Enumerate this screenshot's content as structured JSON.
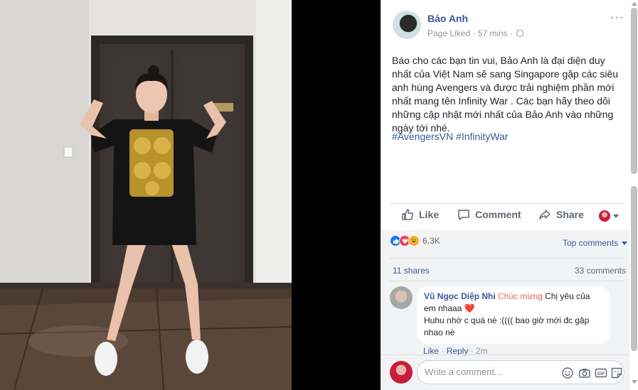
{
  "post": {
    "author": "Bảo Anh",
    "status": "Page Liked",
    "separator": " · ",
    "time": "57 mins",
    "text": "Báo cho các bạn tin vui, Bảo Anh là đại diện duy nhất của Việt Nam sẽ sang Singapore gặp các siêu anh hùng Avengers và được trải nghiệm phần mới nhất mang tên Infinity War . Các bạn hãy theo dõi những cập nhật mới nhất của Bảo Anh vào những ngày tới nhé.",
    "hashtags": [
      "#AvengersVN",
      "#InfinityWar"
    ],
    "more_icon": "more-horizontal-icon"
  },
  "actions": {
    "like": "Like",
    "comment": "Comment",
    "share": "Share"
  },
  "reactions": {
    "icons": [
      "like-reaction-icon",
      "love-reaction-icon",
      "haha-reaction-icon"
    ],
    "count": "6.3K",
    "top_comments": "Top comments"
  },
  "stats": {
    "shares": "11 shares",
    "comments": "33 comments"
  },
  "comment": {
    "author": "Vũ Ngọc Diệp Nhi",
    "mention": "Chúc mừng",
    "text_1": "Chị yêu của em nhaaa",
    "heart": "❤️",
    "text_2": "Huhu nhớ c quá nè :(((( bao giờ mới đc gặp nhao nè",
    "like": "Like",
    "reply": "Reply",
    "time": "2m",
    "dot": " · "
  },
  "composer": {
    "placeholder": "Write a comment...",
    "icons": [
      "emoji-icon",
      "camera-icon",
      "gif-icon",
      "sticker-icon"
    ]
  },
  "colors": {
    "link_blue": "#385898",
    "like_blue": "#1877f2",
    "love_red": "#f33e58",
    "haha_yellow": "#f7b125",
    "mention_red": "#f25f5c"
  }
}
